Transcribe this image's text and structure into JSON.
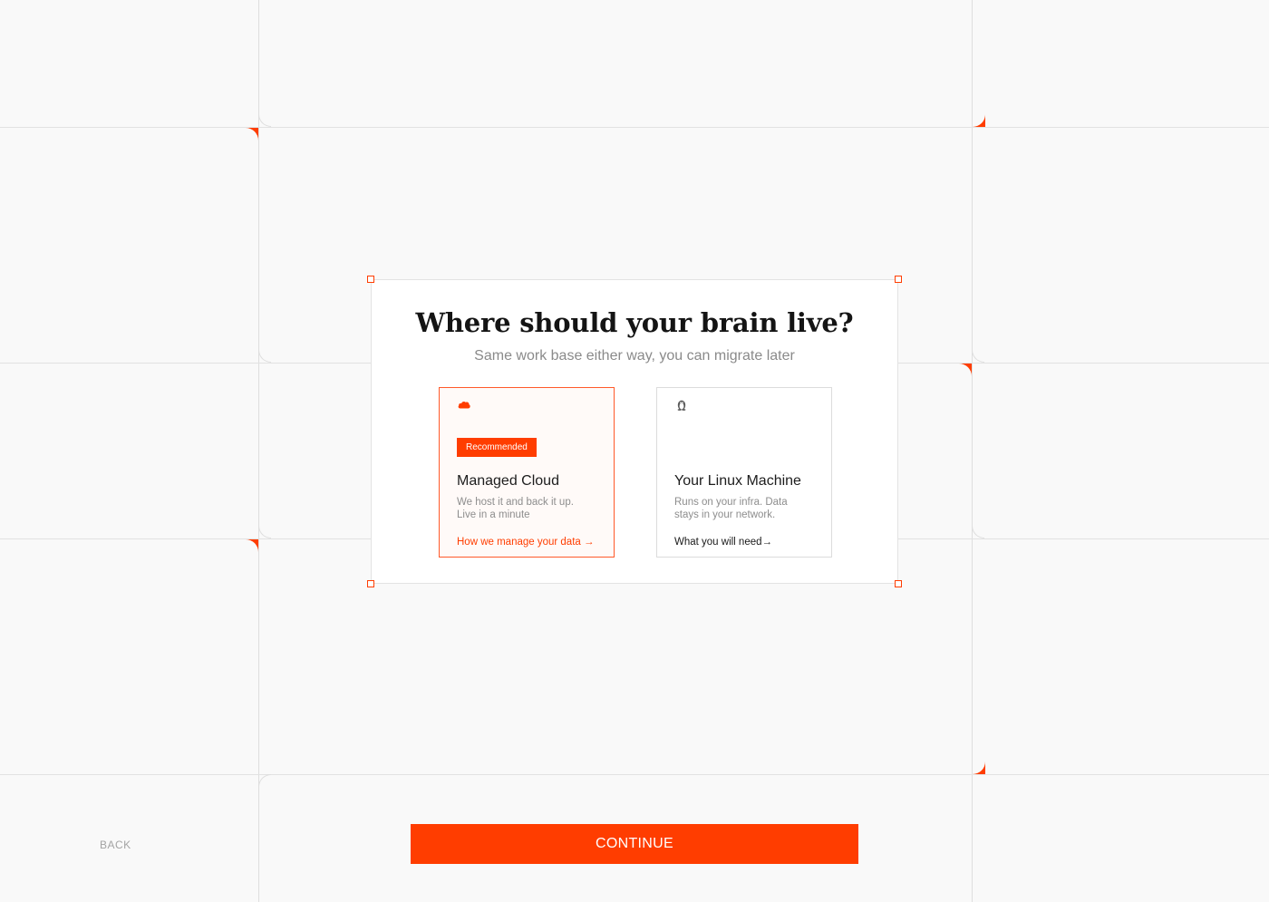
{
  "modal": {
    "title": "Where should your brain live?",
    "subtitle": "Same work base either way, you can migrate later"
  },
  "options": [
    {
      "icon": "cloud-icon",
      "badge": "Recommended",
      "title": "Managed Cloud",
      "description": "We host it and back it up. Live in a minute",
      "link": "How we manage your data →",
      "selected": true
    },
    {
      "icon": "linux-penguin-icon",
      "title": "Your Linux Machine",
      "description": "Runs on your infra. Data stays in your network.",
      "link": "What you will need→",
      "selected": false
    }
  ],
  "footer": {
    "back_label": "BACK",
    "continue_label": "CONTINUE"
  },
  "colors": {
    "accent": "#ff3d00",
    "background": "#f9f9f9",
    "grid_line": "#dedede"
  }
}
